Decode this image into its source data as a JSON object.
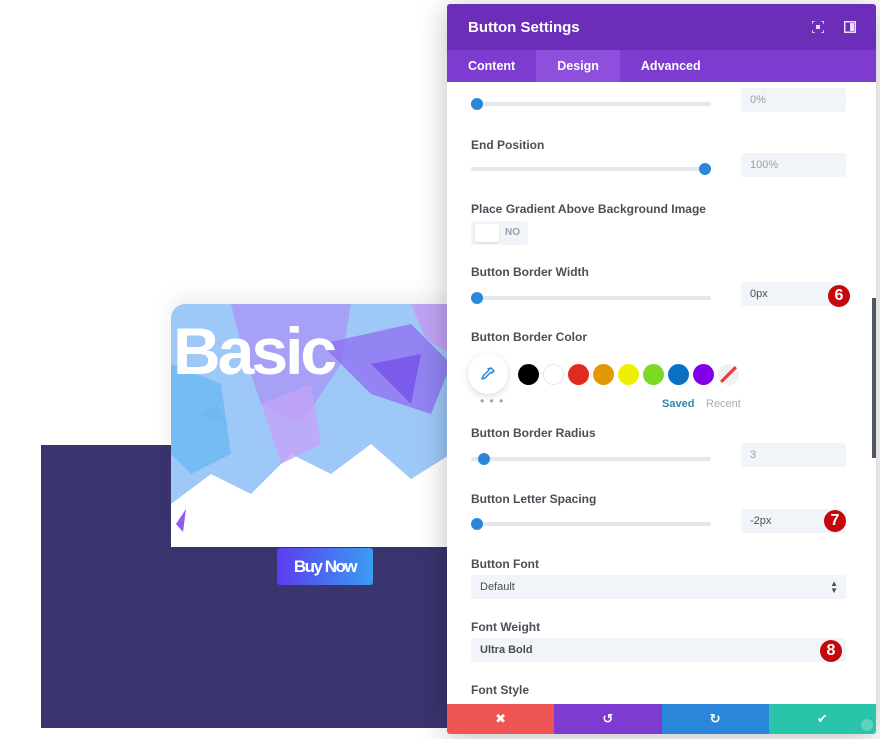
{
  "preview": {
    "card_title": "Basic",
    "button_label": "Buy Now",
    "section_bg": "#3a356f"
  },
  "modal": {
    "title": "Button Settings",
    "header_icons": [
      "expand-icon",
      "sidebar-layout-icon"
    ],
    "tabs": [
      {
        "label": "Content",
        "active": false
      },
      {
        "label": "Design",
        "active": true
      },
      {
        "label": "Advanced",
        "active": false
      }
    ],
    "start_position": {
      "value": "0%",
      "percent": 0
    },
    "end_position": {
      "label": "End Position",
      "value": "100%",
      "percent": 100
    },
    "gradient_above": {
      "label": "Place Gradient Above Background Image",
      "toggle": "NO"
    },
    "border_width": {
      "label": "Button Border Width",
      "value": "0px",
      "percent": 0,
      "badge": "6"
    },
    "border_color": {
      "label": "Button Border Color",
      "swatches": [
        "#000000",
        "#ffffff",
        "#e02b20",
        "#e09900",
        "#edf000",
        "#7cda24",
        "#0c71c3",
        "#8300e9"
      ],
      "more": "• • •",
      "saved": "Saved",
      "recent": "Recent"
    },
    "border_radius": {
      "label": "Button Border Radius",
      "value": "3",
      "percent": 3
    },
    "letter_spacing": {
      "label": "Button Letter Spacing",
      "value": "-2px",
      "percent": 0,
      "badge": "7"
    },
    "button_font": {
      "label": "Button Font",
      "value": "Default"
    },
    "font_weight": {
      "label": "Font Weight",
      "value": "Ultra Bold",
      "badge": "8"
    },
    "font_style": {
      "label": "Font Style"
    },
    "footer": {
      "cancel_color": "#ef5555",
      "undo_color": "#7e3bd0",
      "redo_color": "#2b87da",
      "save_color": "#29c4a9"
    }
  }
}
